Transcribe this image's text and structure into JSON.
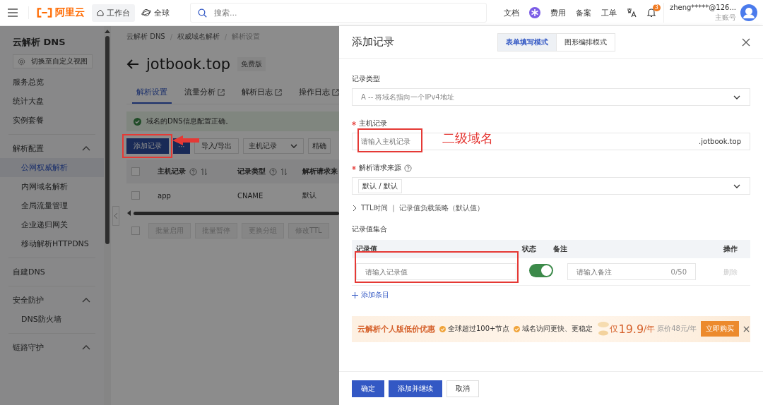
{
  "topbar": {
    "logo_text": "阿里云",
    "nav": [
      {
        "label": "工作台",
        "selected": true
      },
      {
        "label": "全球",
        "selected": false
      }
    ],
    "search": {
      "placeholder": "搜索..."
    },
    "links": [
      {
        "kind": "text",
        "label": "文档"
      },
      {
        "kind": "assistant"
      },
      {
        "kind": "text",
        "label": "费用"
      },
      {
        "kind": "text",
        "label": "备案"
      },
      {
        "kind": "text",
        "label": "工单"
      },
      {
        "kind": "translate"
      },
      {
        "kind": "bell",
        "badge": "3"
      }
    ],
    "user": {
      "name": "zheng*****@126...",
      "role": "主账号"
    }
  },
  "sidebar": {
    "title": "云解析 DNS",
    "view_button": "切换至自定义视图",
    "sections": [
      {
        "children": [
          {
            "label": "服务总览",
            "selected": false
          },
          {
            "label": "统计大盘",
            "selected": false
          },
          {
            "label": "实例套餐",
            "selected": false
          }
        ]
      },
      {
        "label": "解析配置",
        "expanded": true,
        "children": [
          {
            "label": "公网权威解析",
            "selected": true
          },
          {
            "label": "内网域名解析",
            "selected": false
          },
          {
            "label": "全局流量管理",
            "selected": false
          },
          {
            "label": "企业递归网关",
            "selected": false
          },
          {
            "label": "移动解析HTTPDNS",
            "selected": false
          }
        ]
      },
      {
        "label": "自建DNS"
      },
      {
        "label": "安全防护",
        "expanded": true,
        "children": [
          {
            "label": "DNS防火墙",
            "selected": false
          }
        ]
      },
      {
        "label": "链路守护",
        "expanded": true
      }
    ]
  },
  "main": {
    "breadcrumb": [
      "云解析 DNS",
      "权威域名解析",
      "解析设置"
    ],
    "title": "jotbook.top",
    "edition": "免费版",
    "tabs": [
      {
        "label": "解析设置",
        "selected": true,
        "external": false
      },
      {
        "label": "流量分析",
        "selected": false,
        "external": true
      },
      {
        "label": "解析日志",
        "selected": false,
        "external": true
      },
      {
        "label": "操作日志",
        "selected": false,
        "external": true
      }
    ],
    "alert": "域名的DNS信息配置正确。",
    "toolbar": {
      "add_button": "添加记录",
      "more_button": "···",
      "import_button": "导入/导出",
      "filter_select": "主机记录",
      "search_mode": "精确"
    },
    "table": {
      "columns": [
        {
          "label": "主机记录",
          "help": true,
          "sortable": true
        },
        {
          "label": "记录类型",
          "help": true,
          "sortable": true
        },
        {
          "label": "解析请求来",
          "help": false,
          "sortable": false
        }
      ],
      "header_checked": false,
      "rows": [
        {
          "checked": false,
          "cells": [
            "app",
            "CNAME",
            "默认"
          ]
        }
      ]
    },
    "batch": {
      "checked": false,
      "buttons": [
        {
          "label": "批量启用",
          "disabled": true
        },
        {
          "label": "批量暂停",
          "disabled": true
        },
        {
          "label": "更换分组",
          "disabled": true
        },
        {
          "label": "修改TTL",
          "disabled": true
        }
      ]
    }
  },
  "drawer": {
    "title": "添加记录",
    "modes": [
      {
        "label": "表单填写模式",
        "selected": true
      },
      {
        "label": "图形编排模式",
        "selected": false
      }
    ],
    "record_type": {
      "label": "记录类型",
      "value": "A -- 将域名指向一个IPv4地址"
    },
    "host": {
      "label": "主机记录",
      "required": true,
      "placeholder": "请输入主机记录",
      "suffix": ".jotbook.top"
    },
    "source": {
      "label": "解析请求来源",
      "required": true,
      "value": "默认 / 默认"
    },
    "advanced": {
      "expanded": false,
      "label": "TTL时间 ｜ 记录值负载策略（默认值）"
    },
    "values": {
      "title": "记录值集合",
      "columns": [
        "记录值",
        "状态",
        "备注",
        "操作"
      ],
      "rows": [
        {
          "value_placeholder": "请输入记录值",
          "on": true,
          "remark_placeholder": "请输入备注",
          "count": "0/50",
          "action": "删除",
          "action_disabled": true
        }
      ],
      "add_link": "添加条目"
    },
    "promo": {
      "title": "云解析个人版低价优惠",
      "features": [
        "全球超过100+节点",
        "域名访问更快、更稳定"
      ],
      "price_prefix": "仅",
      "price": "19.9",
      "price_unit": "/年",
      "original_price": "原价48元/年",
      "buy_button": "立即购买"
    },
    "footer": [
      {
        "label": "确定",
        "primary": true
      },
      {
        "label": "添加并继续",
        "primary": true
      },
      {
        "label": "取消",
        "primary": false
      }
    ]
  },
  "annotations": {
    "host_note": "二级域名"
  }
}
